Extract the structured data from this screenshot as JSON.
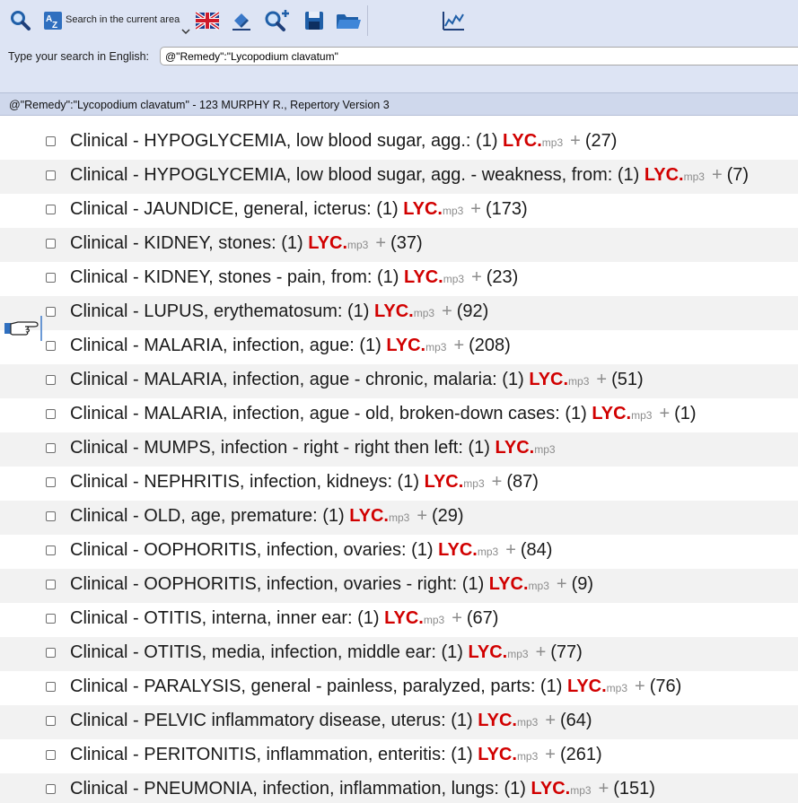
{
  "toolbar": {
    "search_area_label": "Search in the current area",
    "buttons": [
      {
        "name": "search-button",
        "icon": "magnifier-icon"
      },
      {
        "name": "sort-az-button",
        "icon": "az-sort-icon"
      },
      {
        "name": "language-button",
        "icon": "uk-flag-icon"
      },
      {
        "name": "clear-button",
        "icon": "eraser-icon"
      },
      {
        "name": "zoom-in-button",
        "icon": "zoom-plus-icon"
      },
      {
        "name": "save-button",
        "icon": "floppy-disk-icon"
      },
      {
        "name": "open-button",
        "icon": "folder-icon"
      },
      {
        "name": "chart-button",
        "icon": "line-chart-icon"
      }
    ]
  },
  "search": {
    "label": "Type your search in English:",
    "value": "@\"Remedy\":\"Lycopodium clavatum\""
  },
  "status": {
    "text": "@\"Remedy\":\"Lycopodium clavatum\"  - 123 MURPHY R., Repertory Version 3"
  },
  "results": [
    {
      "text": "Clinical - HYPOGLYCEMIA, low blood sugar, agg.: (1) ",
      "remedy": "LYC.",
      "suffix": "mp3",
      "plus": "+",
      "count": "(27)"
    },
    {
      "text": "Clinical - HYPOGLYCEMIA, low blood sugar, agg. - weakness, from: (1) ",
      "remedy": "LYC.",
      "suffix": "mp3",
      "plus": "+",
      "count": "(7)"
    },
    {
      "text": "Clinical - JAUNDICE, general, icterus: (1) ",
      "remedy": "LYC.",
      "suffix": "mp3",
      "plus": "+",
      "count": "(173)"
    },
    {
      "text": "Clinical - KIDNEY, stones: (1) ",
      "remedy": "LYC.",
      "suffix": "mp3",
      "plus": "+",
      "count": "(37)"
    },
    {
      "text": "Clinical - KIDNEY, stones - pain, from: (1) ",
      "remedy": "LYC.",
      "suffix": "mp3",
      "plus": "+",
      "count": "(23)"
    },
    {
      "text": "Clinical - LUPUS, erythematosum: (1) ",
      "remedy": "LYC.",
      "suffix": "mp3",
      "plus": "+",
      "count": "(92)"
    },
    {
      "text": "Clinical - MALARIA, infection, ague: (1) ",
      "remedy": "LYC.",
      "suffix": "mp3",
      "plus": "+",
      "count": "(208)"
    },
    {
      "text": "Clinical - MALARIA, infection, ague - chronic, malaria: (1) ",
      "remedy": "LYC.",
      "suffix": "mp3",
      "plus": "+",
      "count": "(51)"
    },
    {
      "text": "Clinical - MALARIA, infection, ague - old, broken-down cases: (1) ",
      "remedy": "LYC.",
      "suffix": "mp3",
      "plus": "+",
      "count": "(1)"
    },
    {
      "text": "Clinical - MUMPS, infection - right - right then left: (1) ",
      "remedy": "LYC.",
      "suffix": "mp3",
      "plus": "",
      "count": ""
    },
    {
      "text": "Clinical - NEPHRITIS, infection, kidneys: (1) ",
      "remedy": "LYC.",
      "suffix": "mp3",
      "plus": "+",
      "count": "(87)"
    },
    {
      "text": "Clinical - OLD, age, premature: (1) ",
      "remedy": "LYC.",
      "suffix": "mp3",
      "plus": "+",
      "count": "(29)"
    },
    {
      "text": "Clinical - OOPHORITIS, infection, ovaries: (1) ",
      "remedy": "LYC.",
      "suffix": "mp3",
      "plus": "+",
      "count": "(84)"
    },
    {
      "text": "Clinical - OOPHORITIS, infection, ovaries - right: (1) ",
      "remedy": "LYC.",
      "suffix": "mp3",
      "plus": "+",
      "count": "(9)"
    },
    {
      "text": "Clinical - OTITIS, interna, inner ear: (1) ",
      "remedy": "LYC.",
      "suffix": "mp3",
      "plus": "+",
      "count": "(67)"
    },
    {
      "text": "Clinical - OTITIS, media, infection, middle ear: (1) ",
      "remedy": "LYC.",
      "suffix": "mp3",
      "plus": "+",
      "count": "(77)"
    },
    {
      "text": "Clinical - PARALYSIS, general - painless, paralyzed, parts: (1) ",
      "remedy": "LYC.",
      "suffix": "mp3",
      "plus": "+",
      "count": "(76)"
    },
    {
      "text": "Clinical - PELVIC inflammatory disease, uterus: (1) ",
      "remedy": "LYC.",
      "suffix": "mp3",
      "plus": "+",
      "count": "(64)"
    },
    {
      "text": "Clinical - PERITONITIS, inflammation, enteritis: (1) ",
      "remedy": "LYC.",
      "suffix": "mp3",
      "plus": "+",
      "count": "(261)"
    },
    {
      "text": "Clinical - PNEUMONIA, infection, inflammation, lungs: (1) ",
      "remedy": "LYC.",
      "suffix": "mp3",
      "plus": "+",
      "count": "(151)"
    }
  ],
  "colors": {
    "remedy": "#d10000",
    "toolbar_bg": "#dde4f4",
    "status_bg": "#cfd8ec",
    "alt_row": "#f2f2f2"
  }
}
